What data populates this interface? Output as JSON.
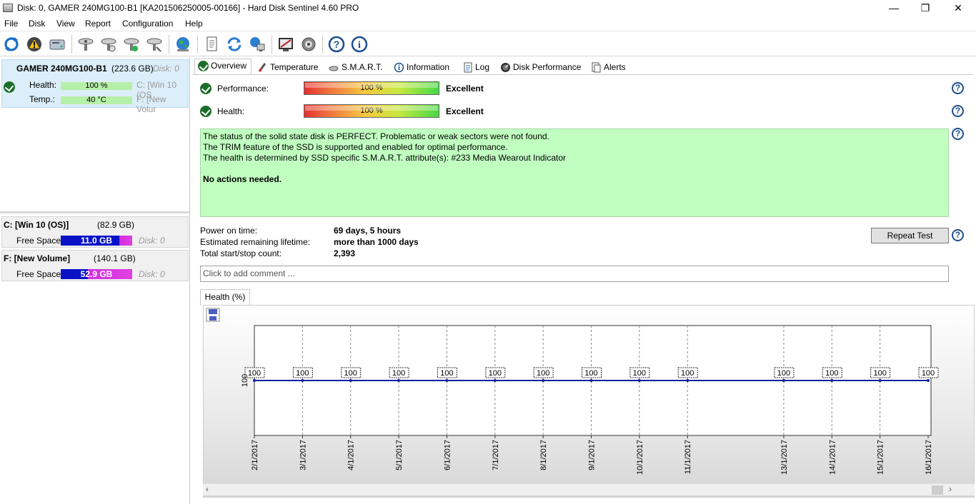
{
  "window": {
    "title": "Disk: 0, GAMER 240MG100-B1 [KA201506250005-00166]  -  Hard Disk Sentinel 4.60 PRO",
    "minimize": "—",
    "maximize": "❐",
    "close": "✕"
  },
  "menu": [
    "File",
    "Disk",
    "View",
    "Report",
    "Configuration",
    "Help"
  ],
  "toolbar": {
    "icons": [
      "refresh-icon",
      "alert-icon",
      "disk-info-icon",
      "disk-test-1-icon",
      "disk-test-2-icon",
      "disk-test-3-icon",
      "disk-test-4-icon",
      "web-icon",
      "document-icon",
      "sync-icon",
      "network-icon",
      "report-icon",
      "speaker-icon",
      "help-icon",
      "info-icon"
    ]
  },
  "left": {
    "disk": {
      "name": "GAMER 240MG100-B1",
      "size": "(223.6 GB)",
      "disk_index": "Disk: 0",
      "health_label": "Health:",
      "health_value": "100 %",
      "health_fraction": 1.0,
      "temp_label": "Temp.:",
      "temp_value": "40 °C",
      "part_c": "C: [Win 10 (OS",
      "part_f": "F: [New Volur"
    },
    "volumes": [
      {
        "name": "C: [Win 10 (OS)]",
        "size": "(82.9 GB)",
        "free_label": "Free Space",
        "free_value": "11.0 GB",
        "disk": "Disk: 0"
      },
      {
        "name": "F: [New Volume]",
        "size": "(140.1 GB)",
        "free_label": "Free Space",
        "free_value": "52.9 GB",
        "disk": "Disk: 0"
      }
    ]
  },
  "tabs": [
    "Overview",
    "Temperature",
    "S.M.A.R.T.",
    "Information",
    "Log",
    "Disk Performance",
    "Alerts"
  ],
  "overview": {
    "performance_label": "Performance:",
    "performance_value": "100 %",
    "performance_rating": "Excellent",
    "health_label": "Health:",
    "health_value": "100 %",
    "health_rating": "Excellent",
    "status_lines": [
      "The status of the solid state disk is PERFECT. Problematic or weak sectors were not found.",
      "The TRIM feature of the SSD is supported and enabled for optimal performance.",
      "The health is determined by SSD specific S.M.A.R.T. attribute(s):  #233 Media Wearout Indicator"
    ],
    "status_action": "No actions needed.",
    "power_on_label": "Power on time:",
    "power_on_value": "69 days, 5 hours",
    "lifetime_label": "Estimated remaining lifetime:",
    "lifetime_value": "more than 1000 days",
    "startstop_label": "Total start/stop count:",
    "startstop_value": "2,393",
    "repeat_test": "Repeat Test",
    "comment_placeholder": "Click to add comment ...",
    "chart_tab": "Health (%)",
    "help_mark": "?"
  },
  "chart_data": {
    "type": "line",
    "title": "",
    "xlabel": "",
    "ylabel": "",
    "x": [
      "2/1/2017",
      "3/1/2017",
      "4/1/2017",
      "5/1/2017",
      "6/1/2017",
      "7/1/2017",
      "8/1/2017",
      "9/1/2017",
      "10/1/2017",
      "11/1/2017",
      "13/1/2017",
      "14/1/2017",
      "15/1/2017",
      "16/1/2017"
    ],
    "values": [
      100,
      100,
      100,
      100,
      100,
      100,
      100,
      100,
      100,
      100,
      100,
      100,
      100,
      100
    ],
    "y_tick": "100",
    "color": "#1020a0"
  }
}
